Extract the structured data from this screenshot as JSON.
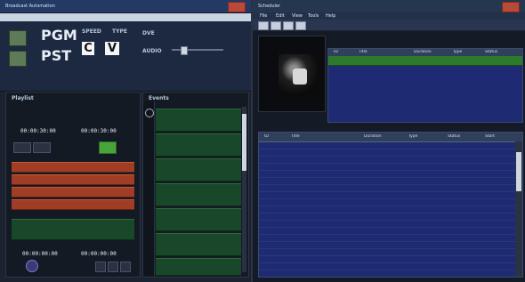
{
  "left": {
    "title": "Broadcast Automation",
    "pgm": "PGM",
    "pst": "PST",
    "speed": "SPEED",
    "type": "TYPE",
    "speed_value": "C",
    "type_value": "V",
    "dve": "DVE",
    "audio": "AUDIO",
    "timecode_a": "00:00:30:00",
    "timecode_b": "00:00:30:00",
    "timecode_c": "00:00:00:00",
    "timecode_d": "00:00:00:00",
    "playlist_header": "Playlist",
    "list_header": "Events"
  },
  "right": {
    "title": "Scheduler",
    "menu": [
      "File",
      "Edit",
      "View",
      "Tools",
      "Help"
    ],
    "grid_top_columns": [
      "ID",
      "Title",
      "Duration",
      "Type",
      "Status"
    ],
    "grid_bottom_columns": [
      "ID",
      "Title",
      "Duration",
      "Type",
      "Status",
      "Start"
    ]
  },
  "colors": {
    "accent": "#1e2b72",
    "green": "#19472a",
    "red": "#a13d24"
  }
}
